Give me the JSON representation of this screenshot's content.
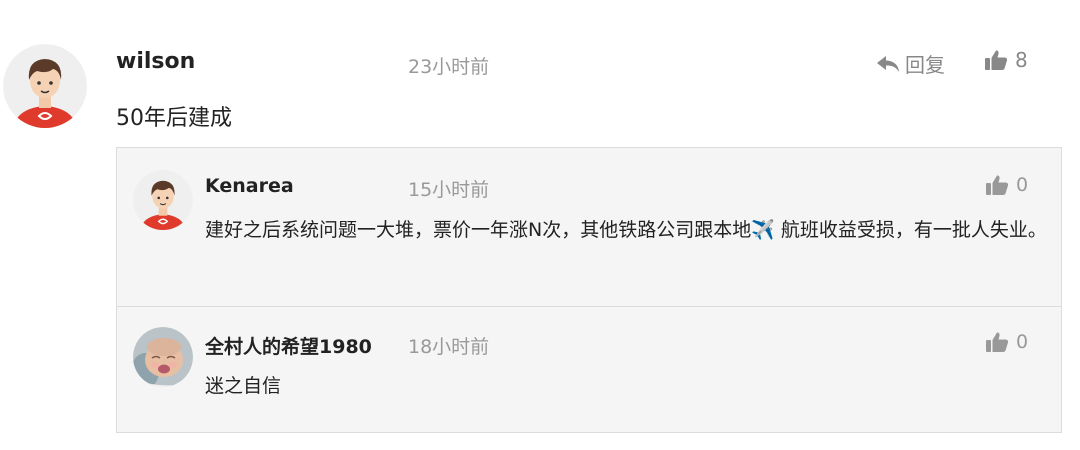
{
  "comment": {
    "author": "wilson",
    "time": "23小时前",
    "reply_label": "回复",
    "likes": "8",
    "content": "50年后建成",
    "avatar_icon": "cartoon-boy-avatar"
  },
  "replies": [
    {
      "author": "Kenarea",
      "time": "15小时前",
      "likes": "0",
      "content": "建好之后系统问题一大堆，票价一年涨N次，其他铁路公司跟本地✈️ 航班收益受损，有一批人失业。",
      "avatar_icon": "cartoon-boy-avatar"
    },
    {
      "author": "全村人的希望1980",
      "time": "18小时前",
      "likes": "0",
      "content": "迷之自信",
      "avatar_icon": "baby-photo-avatar"
    }
  ],
  "colors": {
    "muted": "#999999",
    "reply_bg": "#f5f5f5",
    "avatar_red": "#e03a2c"
  }
}
